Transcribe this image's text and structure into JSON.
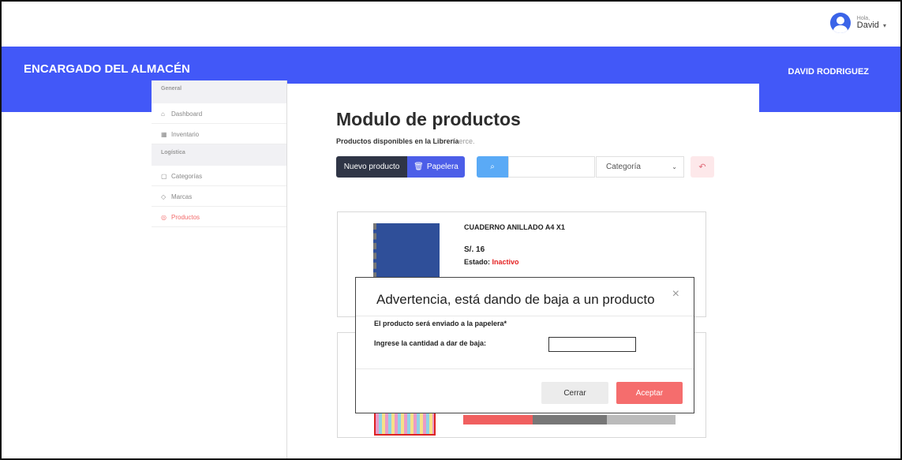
{
  "header": {
    "greeting": "Hola,",
    "user_name": "David",
    "caret": "▾"
  },
  "banner": {
    "title": "ENCARGADO DEL ALMACÉN",
    "user_full_name": "DAVID RODRIGUEZ"
  },
  "sidebar": {
    "sections": [
      {
        "label": "General",
        "items": [
          {
            "icon": "⌂",
            "label": "Dashboard"
          },
          {
            "icon": "▦",
            "label": "Inventario"
          }
        ]
      },
      {
        "label": "Logística",
        "items": [
          {
            "icon": "▢",
            "label": "Categorías"
          },
          {
            "icon": "◇",
            "label": "Marcas"
          },
          {
            "icon": "◎",
            "label": "Productos",
            "active": true
          }
        ]
      }
    ]
  },
  "main": {
    "title": "Modulo de productos",
    "subtitle": "Productos disponibles en la Librería",
    "subtitle_ghost": "erce.",
    "toolbar": {
      "new_label": "Nuevo producto",
      "trash_label": "Papelera",
      "trash_icon": "🗑",
      "search_icon": "⌕",
      "category_placeholder": "Categoría",
      "select_chevron": "⌄",
      "back_icon": "↶"
    },
    "products": [
      {
        "name": "CUADERNO ANILLADO A4 X1",
        "price": "S/. 16",
        "status_label": "Estado:",
        "status_value": "Inactivo"
      }
    ]
  },
  "modal": {
    "title": "Advertencia, está dando de baja a un producto",
    "close_icon": "×",
    "line1": "El producto será enviado a la papelera*",
    "line2": "Ingrese la cantidad a dar de baja:",
    "close_label": "Cerrar",
    "accept_label": "Aceptar"
  },
  "colors": {
    "banner": "#4258f8",
    "accent_red": "#f56d6d",
    "status_red": "#e52222"
  }
}
